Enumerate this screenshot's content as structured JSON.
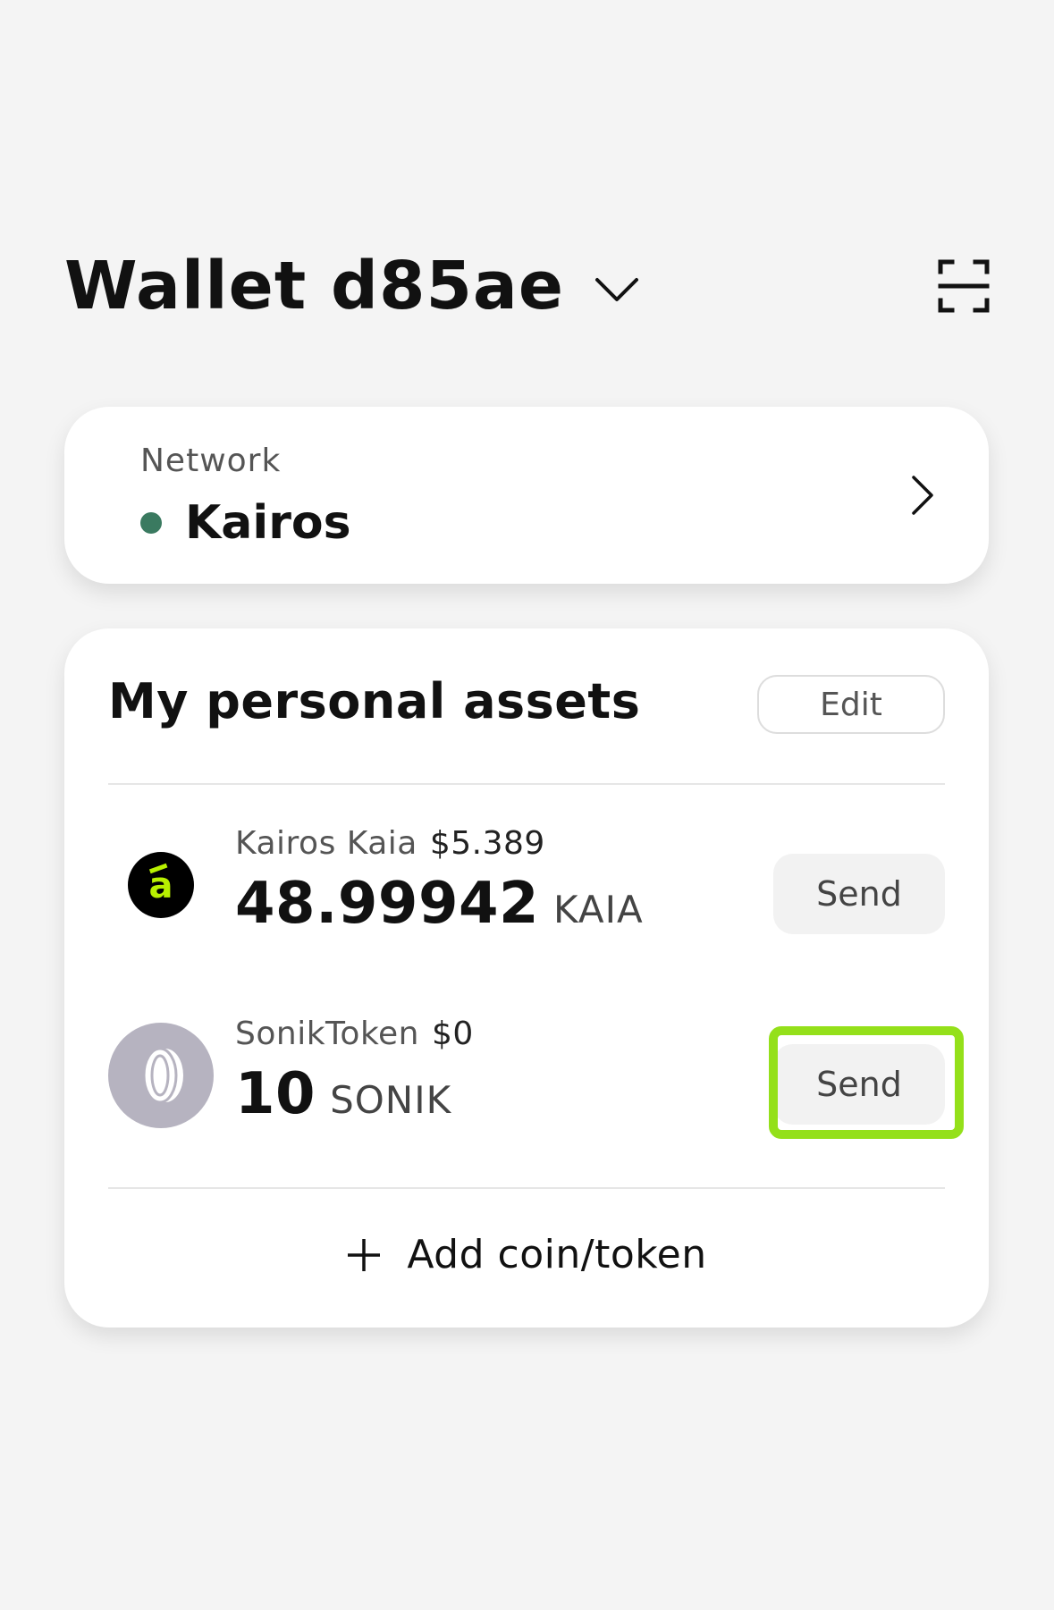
{
  "header": {
    "wallet_name": "Wallet d85ae"
  },
  "network": {
    "label": "Network",
    "value": "Kairos",
    "status_color": "#3a7a60"
  },
  "assets": {
    "title": "My personal assets",
    "edit_label": "Edit",
    "items": [
      {
        "name": "Kairos Kaia",
        "price": "$5.389",
        "amount": "48.99942",
        "symbol": "KAIA",
        "icon": "kaia-logo-icon",
        "send_label": "Send"
      },
      {
        "name": "SonikToken",
        "price": "$0",
        "amount": "10",
        "symbol": "SONIK",
        "icon": "generic-coin-icon",
        "send_label": "Send"
      }
    ],
    "add_label": "Add coin/token"
  },
  "colors": {
    "accent_highlight": "#94e01a",
    "kaia_green": "#b8f000"
  }
}
